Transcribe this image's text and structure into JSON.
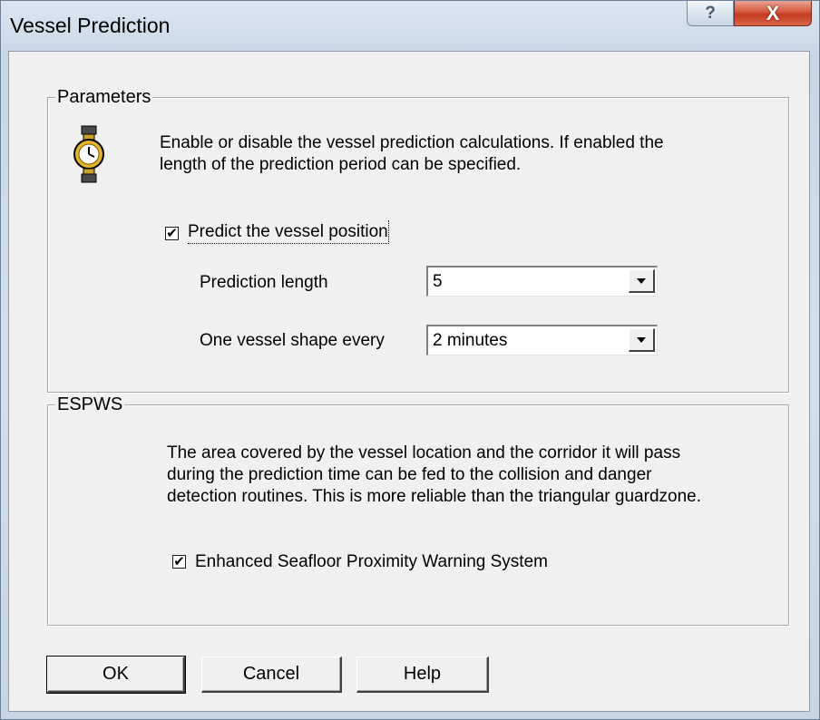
{
  "window": {
    "title": "Vessel Prediction",
    "help_glyph": "?",
    "close_glyph": "X"
  },
  "parameters": {
    "group_label": "Parameters",
    "icon": "stopwatch-icon",
    "description_line1": "Enable or disable the vessel prediction calculations. If enabled the",
    "description_line2": "length of the prediction period can be specified.",
    "predict_checkbox": {
      "label": "Predict the vessel position",
      "checked": true
    },
    "prediction_length": {
      "label": "Prediction length",
      "value": "5"
    },
    "shape_every": {
      "label": "One vessel shape every",
      "value": "2 minutes"
    }
  },
  "espws": {
    "group_label": "ESPWS",
    "description_line1": "The area covered by the vessel location and the corridor it will pass",
    "description_line2": "during the prediction time can be fed to the collision and danger",
    "description_line3": "detection routines. This is more reliable than the triangular guardzone.",
    "enhanced_checkbox": {
      "label": "Enhanced Seafloor Proximity Warning System",
      "checked": true
    }
  },
  "buttons": {
    "ok": "OK",
    "cancel": "Cancel",
    "help": "Help"
  },
  "check_glyph": "✔"
}
